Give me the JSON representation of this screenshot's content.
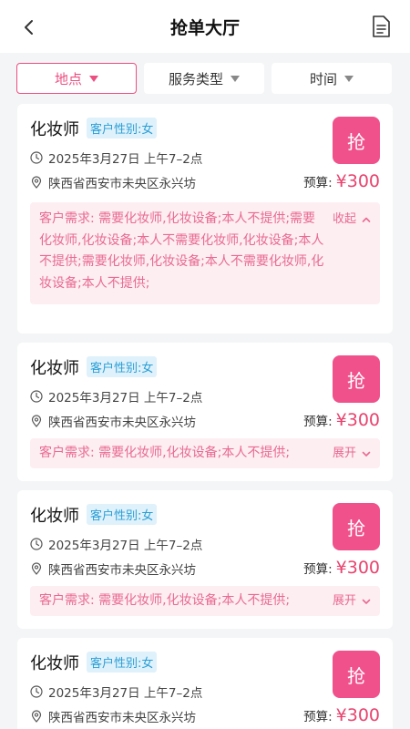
{
  "header": {
    "title": "抢单大厅",
    "back_icon": "chevron-left-icon",
    "doc_icon": "document-icon"
  },
  "filters": [
    {
      "label": "地点",
      "active": true
    },
    {
      "label": "服务类型",
      "active": false
    },
    {
      "label": "时间",
      "active": false
    }
  ],
  "colors": {
    "accent": "#f0518b",
    "price": "#e8436e",
    "badge_bg": "#dff1fb",
    "badge_text": "#2b9fd6",
    "req_bg": "#fdeef2"
  },
  "orders": [
    {
      "role": "化妆师",
      "gender": "客户性别:女",
      "time": "2025年3月27日 上午7–2点",
      "address": "陕西省西安市未央区永兴坊",
      "grab": "抢",
      "budget_label": "预算:",
      "budget": "¥300",
      "req_label": "客户需求:",
      "req_text": "需要化妆师,化妆设备;本人不提供;需要化妆师,化妆设备;本人不需要化妆师,化妆设备;本人不提供;需要化妆师,化妆设备;本人不需要化妆师,化妆设备;本人不提供;",
      "toggle": "收起"
    },
    {
      "role": "化妆师",
      "gender": "客户性别:女",
      "time": "2025年3月27日 上午7–2点",
      "address": "陕西省西安市未央区永兴坊",
      "grab": "抢",
      "budget_label": "预算:",
      "budget": "¥300",
      "req_label": "客户需求:",
      "req_text": "需要化妆师,化妆设备;本人不提供;",
      "toggle": "展开"
    },
    {
      "role": "化妆师",
      "gender": "客户性别:女",
      "time": "2025年3月27日 上午7–2点",
      "address": "陕西省西安市未央区永兴坊",
      "grab": "抢",
      "budget_label": "预算:",
      "budget": "¥300",
      "req_label": "客户需求:",
      "req_text": "需要化妆师,化妆设备;本人不提供;",
      "toggle": "展开"
    },
    {
      "role": "化妆师",
      "gender": "客户性别:女",
      "time": "2025年3月27日 上午7–2点",
      "address": "陕西省西安市未央区永兴坊",
      "grab": "抢",
      "budget_label": "预算:",
      "budget": "¥300"
    }
  ]
}
